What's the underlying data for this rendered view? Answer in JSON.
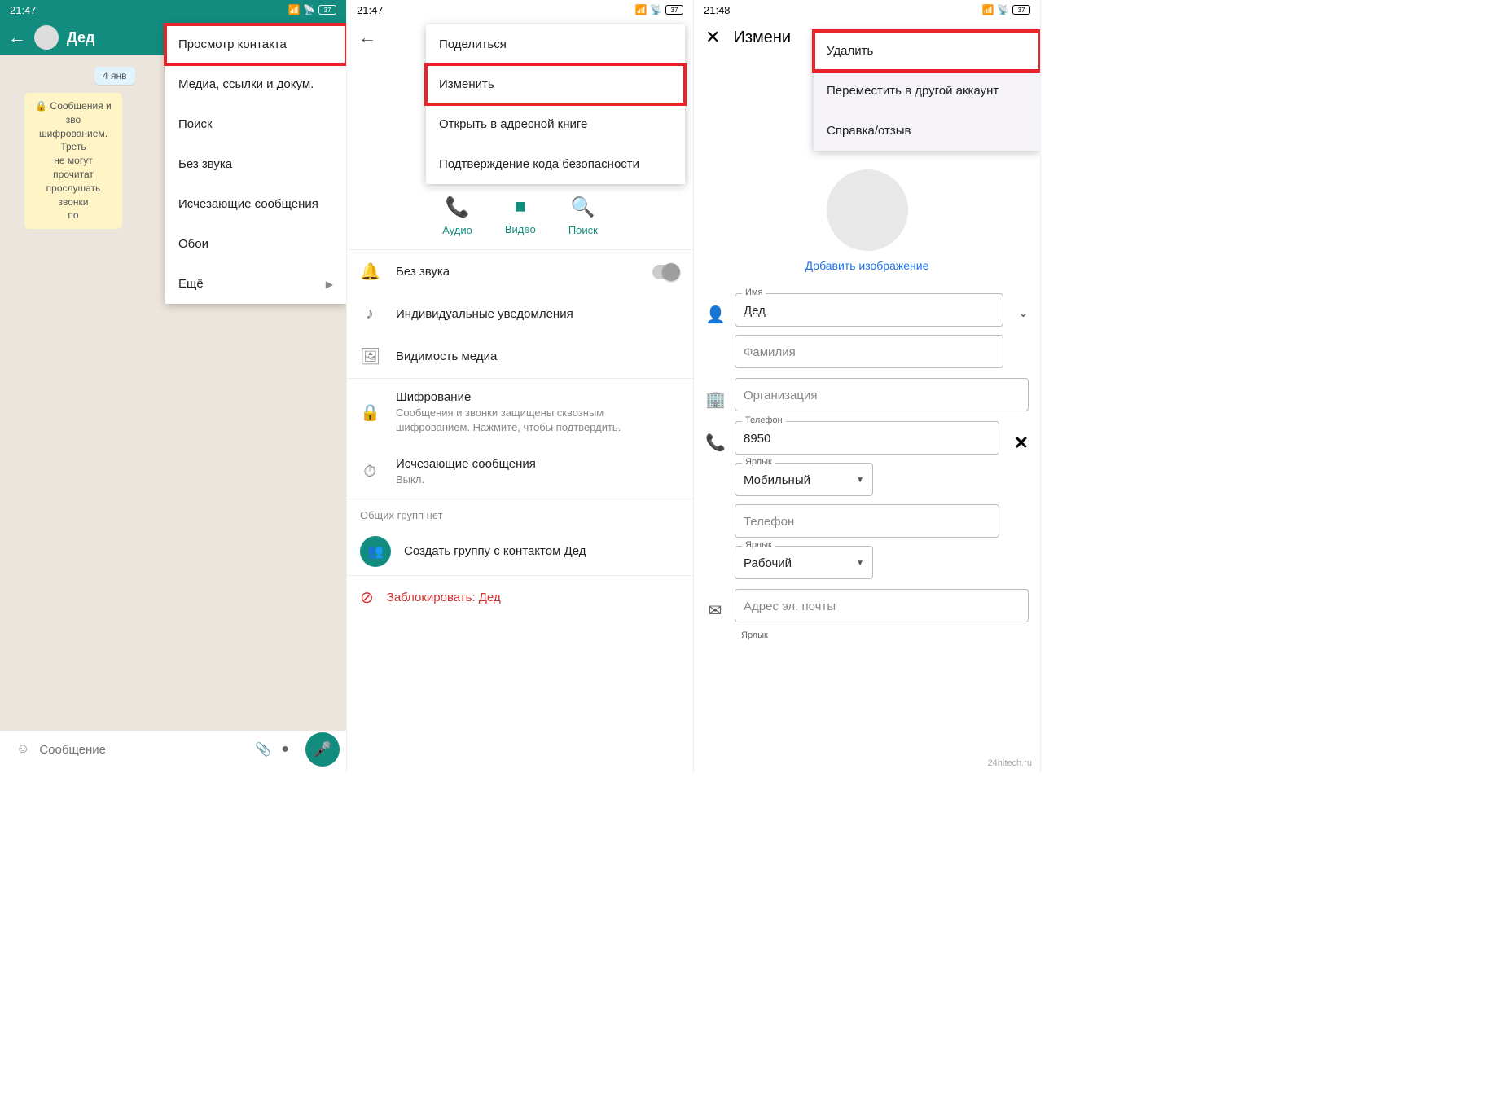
{
  "status": {
    "time1": "21:47",
    "time2": "21:47",
    "time3": "21:48",
    "battery": "37"
  },
  "col1": {
    "contact_name": "Дед",
    "date_chip": "4 янв",
    "encryption_msg": "🔒 Сообщения и зво\nшифрованием. Треть\nне могут прочитат\nпрослушать звонки\nпо",
    "menu": {
      "view_contact": "Просмотр контакта",
      "media": "Медиа, ссылки и докум.",
      "search": "Поиск",
      "mute": "Без звука",
      "disappearing": "Исчезающие сообщения",
      "wallpaper": "Обои",
      "more": "Ещё"
    },
    "input_placeholder": "Сообщение"
  },
  "col2": {
    "menu": {
      "share": "Поделиться",
      "edit": "Изменить",
      "addressbook": "Открыть в адресной книге",
      "security": "Подтверждение кода безопасности"
    },
    "actions": {
      "audio": "Аудио",
      "video": "Видео",
      "search": "Поиск"
    },
    "mute": "Без звука",
    "notifications": "Индивидуальные уведомления",
    "media_visibility": "Видимость медиа",
    "encryption_title": "Шифрование",
    "encryption_sub": "Сообщения и звонки защищены сквозным шифрованием. Нажмите, чтобы подтвердить.",
    "disappearing_title": "Исчезающие сообщения",
    "disappearing_sub": "Выкл.",
    "no_groups": "Общих групп нет",
    "create_group": "Создать группу с контактом Дед",
    "block": "Заблокировать: Дед"
  },
  "col3": {
    "title": "Измени",
    "menu": {
      "delete": "Удалить",
      "move": "Переместить в другой аккаунт",
      "help": "Справка/отзыв"
    },
    "add_image": "Добавить изображение",
    "name_label": "Имя",
    "name_value": "Дед",
    "surname_placeholder": "Фамилия",
    "org_placeholder": "Организация",
    "phone_label": "Телефон",
    "phone_value": "8950",
    "label1_label": "Ярлык",
    "label1_value": "Мобильный",
    "phone2_placeholder": "Телефон",
    "label2_label": "Ярлык",
    "label2_value": "Рабочий",
    "email_placeholder": "Адрес эл. почты",
    "label3_label": "Ярлык"
  },
  "watermark": "24hitech.ru"
}
